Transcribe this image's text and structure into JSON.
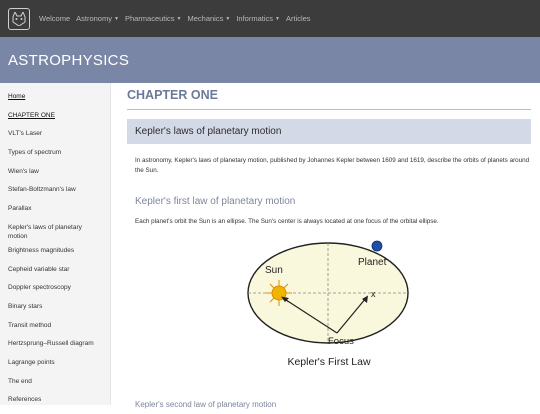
{
  "nav": {
    "items": [
      {
        "label": "Welcome",
        "dropdown": false
      },
      {
        "label": "Astronomy",
        "dropdown": true
      },
      {
        "label": "Pharmaceutics",
        "dropdown": true
      },
      {
        "label": "Mechanics",
        "dropdown": true
      },
      {
        "label": "Informatics",
        "dropdown": true
      },
      {
        "label": "Articles",
        "dropdown": false
      }
    ]
  },
  "banner": {
    "title": "ASTROPHYSICS"
  },
  "sidebar": {
    "items": [
      {
        "label": "Home"
      },
      {
        "label": "CHAPTER ONE"
      },
      {
        "label": "VLT's Laser"
      },
      {
        "label": "Types of spectrum"
      },
      {
        "label": "Wien's law"
      },
      {
        "label": "Stefan-Boltzmann's law"
      },
      {
        "label": "Parallax"
      },
      {
        "label": "Kepler's laws of planetary motion"
      },
      {
        "label": "Brightness magnitudes"
      },
      {
        "label": "Cepheid variable star"
      },
      {
        "label": "Doppler spectroscopy"
      },
      {
        "label": "Binary stars"
      },
      {
        "label": "Transit method"
      },
      {
        "label": "Hertzsprung–Russell diagram"
      },
      {
        "label": "Lagrange points"
      },
      {
        "label": "The end"
      },
      {
        "label": "References"
      }
    ]
  },
  "main": {
    "chapter_title": "CHAPTER ONE",
    "section_title": "Kepler's laws of planetary motion",
    "intro": "In astronomy, Kepler's laws of planetary motion, published by Johannes Kepler between 1609 and 1619, describe the orbits of planets around the Sun.",
    "first_law_title": "Kepler's first law of planetary motion",
    "first_law_text": "Each planet's orbit the Sun is an ellipse. The Sun's center is always located at one focus of the orbital ellipse.",
    "figure": {
      "sun_label": "Sun",
      "planet_label": "Planet",
      "focus_label": "Focus",
      "x_label": "x",
      "caption": "Kepler's First Law"
    },
    "next_title": "Kepler's second law of planetary motion"
  },
  "colors": {
    "navbar": "#3c3c3c",
    "banner": "#7a86a6",
    "section_bg": "#d4d9e8",
    "sun": "#f0b500",
    "planet": "#1f4fa8"
  }
}
